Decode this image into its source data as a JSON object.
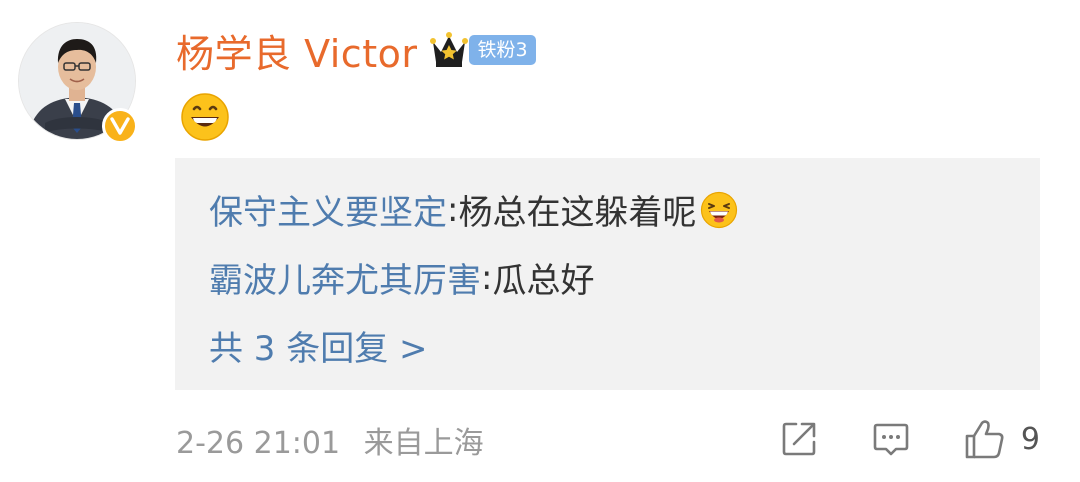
{
  "comment": {
    "author": "杨学良 Victor",
    "fan_badge": "铁粉3",
    "body_icon": "grinning-face-emoji",
    "verified_icon": "verified-v-icon",
    "crown_icon": "crown-icon",
    "avatar_icon": "user-avatar"
  },
  "replies": [
    {
      "author": "保守主义要坚定",
      "separator": ": ",
      "text": "杨总在这躲着呢",
      "emoji": "laughing-face-emoji"
    },
    {
      "author": "霸波儿奔尤其厉害",
      "separator": ": ",
      "text": "瓜总好"
    }
  ],
  "more_replies_label": "共 3 条回复 >",
  "footer": {
    "timestamp": "2-26 21:01",
    "location": "来自上海",
    "like_count": "9"
  },
  "colors": {
    "author": "#e86a2c",
    "reply_author": "#4f7cae",
    "fan_badge_bg": "#7fb2ea",
    "verified": "#f9b21a",
    "replies_bg": "#f2f2f2",
    "muted": "#9a9a9a"
  }
}
